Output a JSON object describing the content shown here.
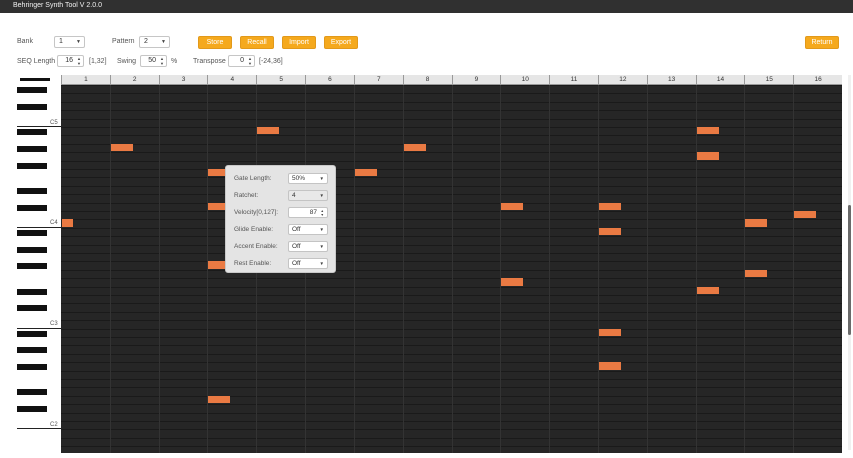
{
  "window": {
    "title": "Behringer Synth Tool V 2.0.0"
  },
  "controls": {
    "bank_label": "Bank",
    "bank_value": "1",
    "pattern_label": "Pattern",
    "pattern_value": "2",
    "seq_length_label": "SEQ Length",
    "seq_length_value": "16",
    "seq_length_range": "[1,32]",
    "swing_label": "Swing",
    "swing_value": "50",
    "swing_unit": "%",
    "transpose_label": "Transpose",
    "transpose_value": "0",
    "transpose_range": "[-24,36]"
  },
  "buttons": {
    "store": "Store",
    "recall": "Recall",
    "import": "Import",
    "export": "Export",
    "return": "Return"
  },
  "colors": {
    "accent": "#f5a91d",
    "note": "#ea7a43",
    "grid": "#262626"
  },
  "octave_labels": [
    "C5",
    "C4",
    "C3",
    "C2"
  ],
  "steps": [
    "1",
    "2",
    "3",
    "4",
    "5",
    "6",
    "7",
    "8",
    "9",
    "10",
    "11",
    "12",
    "13",
    "14",
    "15",
    "16"
  ],
  "notes": [
    {
      "step": 1,
      "row": 16
    },
    {
      "step": 2,
      "row": 7
    },
    {
      "step": 4,
      "row": 10
    },
    {
      "step": 4,
      "row": 14
    },
    {
      "step": 4,
      "row": 21
    },
    {
      "step": 4,
      "row": 37
    },
    {
      "step": 5,
      "row": 5
    },
    {
      "step": 7,
      "row": 10
    },
    {
      "step": 8,
      "row": 7
    },
    {
      "step": 10,
      "row": 14
    },
    {
      "step": 10,
      "row": 23
    },
    {
      "step": 12,
      "row": 14
    },
    {
      "step": 12,
      "row": 17
    },
    {
      "step": 12,
      "row": 29
    },
    {
      "step": 12,
      "row": 33
    },
    {
      "step": 14,
      "row": 5
    },
    {
      "step": 14,
      "row": 8
    },
    {
      "step": 14,
      "row": 24
    },
    {
      "step": 15,
      "row": 16
    },
    {
      "step": 15,
      "row": 22
    },
    {
      "step": 16,
      "row": 15
    }
  ],
  "popup": {
    "gate_length_label": "Gate Length:",
    "gate_length_value": "50%",
    "ratchet_label": "Ratchet:",
    "ratchet_value": "4",
    "velocity_label": "Velocity[0,127]:",
    "velocity_value": "87",
    "glide_label": "Glide Enable:",
    "glide_value": "Off",
    "accent_label": "Accent Enable:",
    "accent_value": "Off",
    "rest_label": "Rest Enable:",
    "rest_value": "Off"
  }
}
